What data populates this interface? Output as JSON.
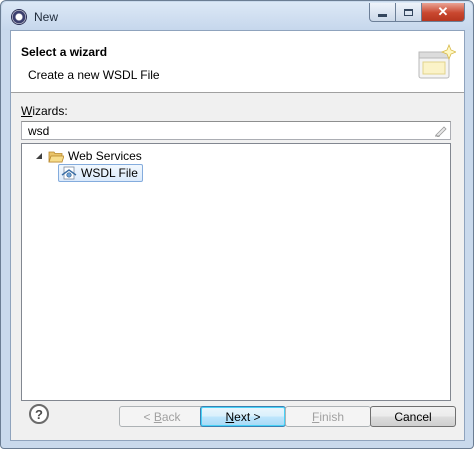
{
  "window": {
    "title": "New",
    "colors": {
      "frame": "#c9d9ec",
      "close_button": "#c9472f",
      "selection_border": "#84acdd"
    }
  },
  "header": {
    "title": "Select a wizard",
    "description": "Create a new WSDL File"
  },
  "wizards": {
    "label_mnemonic": "W",
    "label_rest": "izards:",
    "filter_value": "wsd"
  },
  "tree": {
    "category": {
      "label": "Web Services",
      "expanded": true,
      "icon": "folder-open-icon"
    },
    "item": {
      "label": "WSDL File",
      "selected": true,
      "icon": "wsdl-file-icon"
    }
  },
  "buttons": {
    "help": "?",
    "back": {
      "prefix": "< ",
      "mnemonic": "B",
      "rest": "ack",
      "enabled": false
    },
    "next": {
      "mnemonic": "N",
      "rest": "ext >",
      "enabled": true
    },
    "finish": {
      "mnemonic": "F",
      "rest": "inish",
      "enabled": false
    },
    "cancel": {
      "label": "Cancel",
      "enabled": true
    }
  }
}
